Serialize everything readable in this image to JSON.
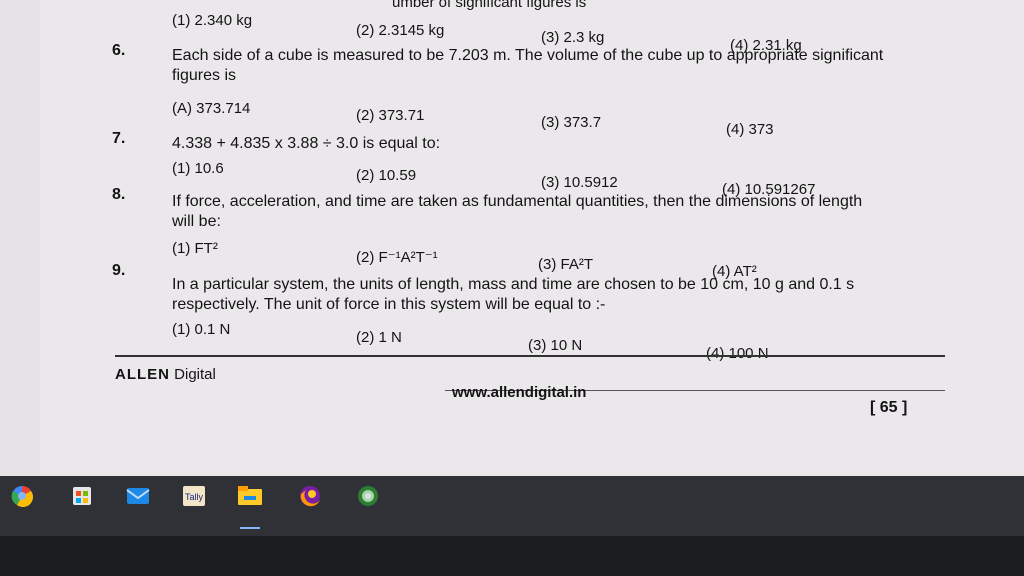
{
  "top_options": {
    "o1": "(1) 2.340 kg",
    "o2": "(2) 2.3145 kg",
    "o3": "(3) 2.3 kg",
    "o4": "(4) 2.31 kg",
    "cut_text": "umber of significant figures is"
  },
  "q6": {
    "num": "6.",
    "stem1": "Each side of a cube is measured to be 7.203 m. The volume of the cube up to appropriate significant",
    "stem2": "figures is",
    "o1": "(A) 373.714",
    "o2": "(2) 373.71",
    "o3": "(3) 373.7",
    "o4": "(4) 373"
  },
  "q7": {
    "num": "7.",
    "stem": "4.338 + 4.835 x 3.88 ÷ 3.0 is equal to:",
    "o1": "(1) 10.6",
    "o2": "(2) 10.59",
    "o3": "(3) 10.5912",
    "o4": "(4) 10.591267"
  },
  "q8": {
    "num": "8.",
    "stem1": "If force, acceleration, and time are taken as fundamental quantities, then the dimensions of length",
    "stem2": "will be:",
    "o1": "(1) FT²",
    "o2": "(2) F⁻¹A²T⁻¹",
    "o3": "(3) FA²T",
    "o4": "(4) AT²"
  },
  "q9": {
    "num": "9.",
    "stem1": "In a particular system, the units of length, mass and time are chosen to be 10 cm, 10 g and 0.1 s",
    "stem2": "respectively. The unit of force in this system will be equal to :-",
    "o1": "(1) 0.1 N",
    "o2": "(2) 1 N",
    "o3": "(3) 10 N",
    "o4": "(4) 100 N"
  },
  "footer": {
    "brand": "ALLEN",
    "brand_suffix": "Digital",
    "url": "www.allendigital.in",
    "page": "[ 65 ]"
  },
  "taskbar": {
    "icons": [
      "chrome-icon",
      "store-icon",
      "mail-icon",
      "tally-icon",
      "file-explorer-icon",
      "firefox-icon",
      "chrome-canary-icon"
    ],
    "tally_label": "Tally"
  },
  "colors": {
    "page_bg": "#ebe8eb",
    "taskbar_bg": "#2f3136",
    "text": "#141414"
  }
}
